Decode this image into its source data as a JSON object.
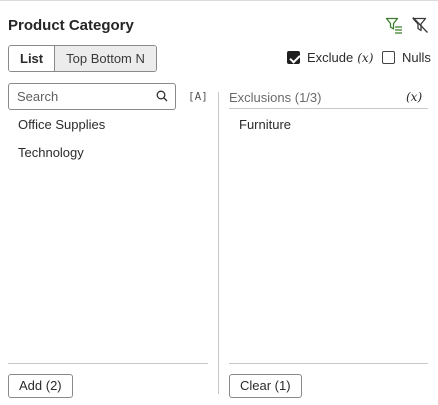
{
  "panel": {
    "title": "Product Category",
    "icons": {
      "filter_settings": "filter-settings-icon",
      "clear_filter": "clear-filter-icon"
    },
    "accent_color": "#3a7d2c"
  },
  "mode_tabs": [
    {
      "label": "List",
      "selected": true
    },
    {
      "label": "Top Bottom N",
      "selected": false
    }
  ],
  "options": {
    "exclude": {
      "label": "Exclude",
      "fx": "(x)",
      "checked": true
    },
    "nulls": {
      "label": "Nulls",
      "checked": false
    }
  },
  "search": {
    "placeholder": "Search",
    "value": ""
  },
  "match_case_label": "[A]",
  "available": {
    "items": [
      "Office Supplies",
      "Technology"
    ],
    "add_label": "Add (2)"
  },
  "exclusions": {
    "header": "Exclusions (1/3)",
    "fx": "(x)",
    "items": [
      "Furniture"
    ],
    "clear_label": "Clear (1)"
  }
}
